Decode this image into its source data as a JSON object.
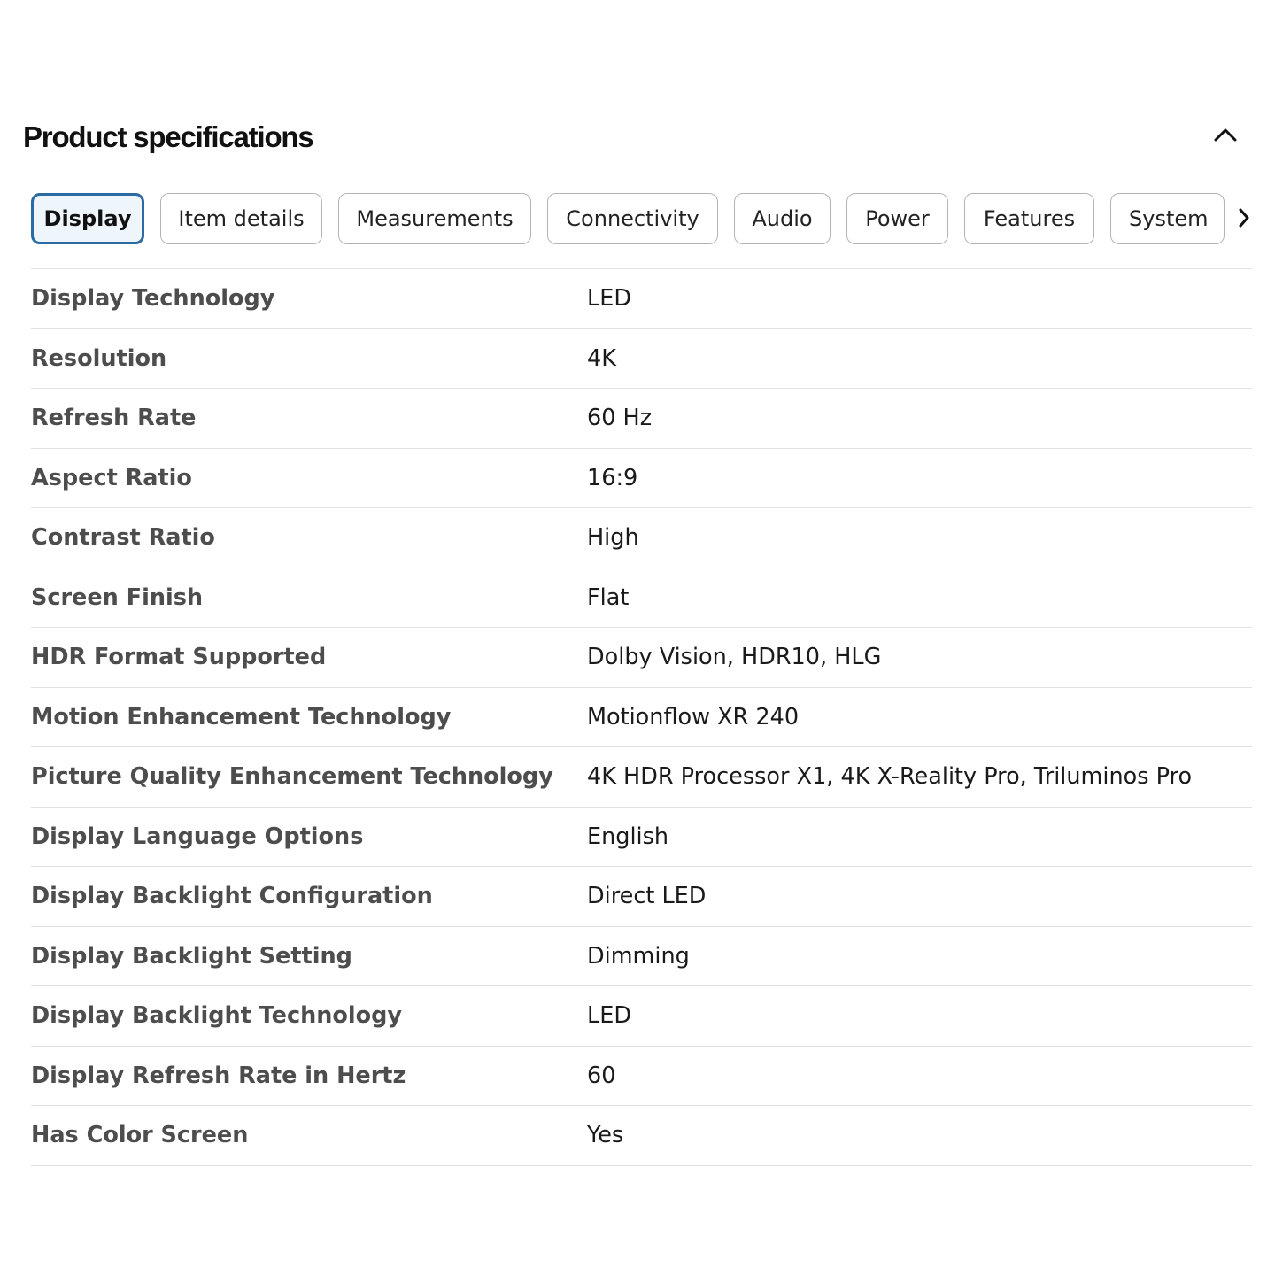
{
  "header": {
    "title": "Product specifications",
    "collapse_icon": "chevron-up-icon"
  },
  "tabs": [
    {
      "label": "Display",
      "active": true
    },
    {
      "label": "Item details",
      "active": false
    },
    {
      "label": "Measurements",
      "active": false
    },
    {
      "label": "Connectivity",
      "active": false
    },
    {
      "label": "Audio",
      "active": false
    },
    {
      "label": "Power",
      "active": false
    },
    {
      "label": "Features",
      "active": false
    },
    {
      "label": "System",
      "active": false
    }
  ],
  "tabs_next_icon": "chevron-right-icon",
  "specs": [
    {
      "key": "Display Technology",
      "value": "LED"
    },
    {
      "key": "Resolution",
      "value": "4K"
    },
    {
      "key": "Refresh Rate",
      "value": "60 Hz"
    },
    {
      "key": "Aspect Ratio",
      "value": "16:9"
    },
    {
      "key": "Contrast Ratio",
      "value": "High"
    },
    {
      "key": "Screen Finish",
      "value": "Flat"
    },
    {
      "key": "HDR Format Supported",
      "value": "Dolby Vision, HDR10, HLG"
    },
    {
      "key": "Motion Enhancement Technology",
      "value": "Motionflow XR 240"
    },
    {
      "key": "Picture Quality Enhancement Technology",
      "value": "4K HDR Processor X1, 4K X-Reality Pro, Triluminos Pro"
    },
    {
      "key": "Display Language Options",
      "value": "English"
    },
    {
      "key": "Display Backlight Configuration",
      "value": "Direct LED"
    },
    {
      "key": "Display Backlight Setting",
      "value": "Dimming"
    },
    {
      "key": "Display Backlight Technology",
      "value": "LED"
    },
    {
      "key": "Display Refresh Rate in Hertz",
      "value": "60"
    },
    {
      "key": "Has Color Screen",
      "value": "Yes"
    }
  ],
  "colors": {
    "active_tab_border": "#2b6aa3",
    "active_tab_bg": "#eef5fb",
    "tab_border": "#b4b4b4",
    "row_divider": "#e2e2e2",
    "key_text": "#4d4d4d",
    "value_text": "#1a1a1a"
  }
}
